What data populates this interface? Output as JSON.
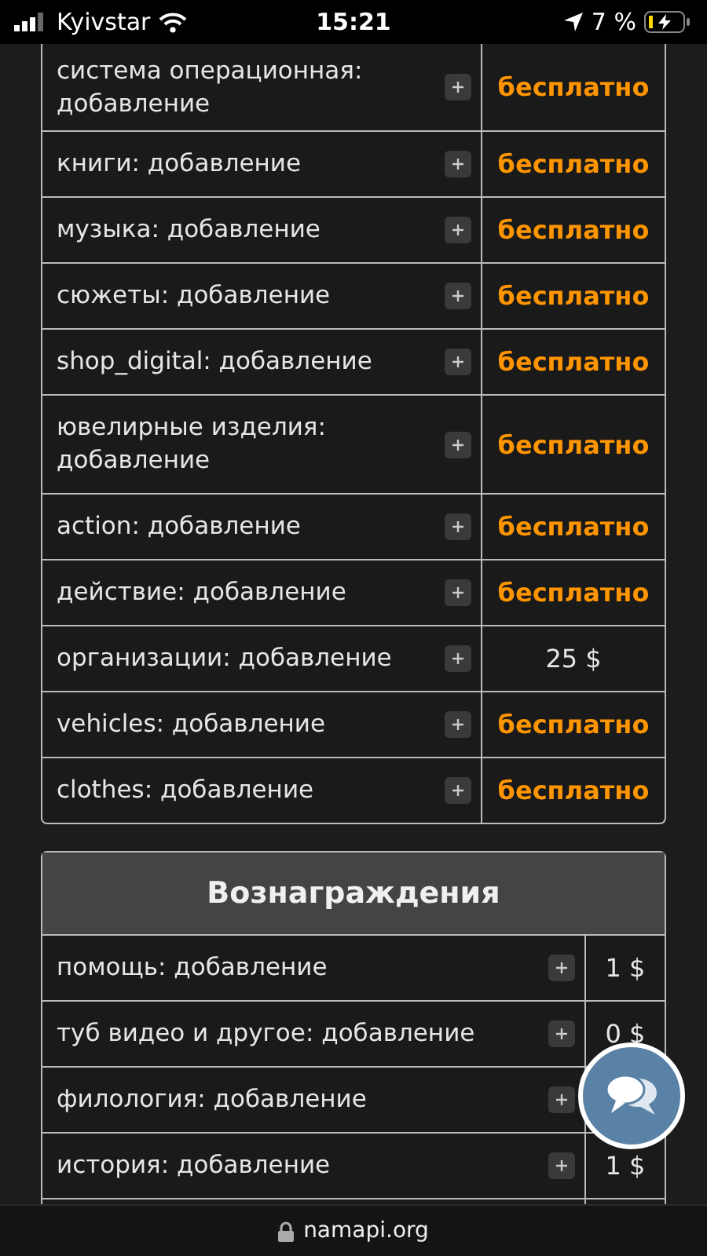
{
  "status_bar": {
    "carrier": "Kyivstar",
    "time": "15:21",
    "battery": "7 %"
  },
  "features_table": {
    "rows": [
      {
        "name": "система операционная: добавление",
        "price": "бесплатно",
        "free": true
      },
      {
        "name": "книги: добавление",
        "price": "бесплатно",
        "free": true
      },
      {
        "name": "музыка: добавление",
        "price": "бесплатно",
        "free": true
      },
      {
        "name": "сюжеты: добавление",
        "price": "бесплатно",
        "free": true
      },
      {
        "name": "shop_digital: добавление",
        "price": "бесплатно",
        "free": true
      },
      {
        "name": "ювелирные изделия: добавление",
        "price": "бесплатно",
        "free": true
      },
      {
        "name": "action: добавление",
        "price": "бесплатно",
        "free": true
      },
      {
        "name": "действие: добавление",
        "price": "бесплатно",
        "free": true
      },
      {
        "name": "организации: добавление",
        "price": "25 $",
        "free": false
      },
      {
        "name": "vehicles: добавление",
        "price": "бесплатно",
        "free": true
      },
      {
        "name": "clothes: добавление",
        "price": "бесплатно",
        "free": true
      }
    ]
  },
  "rewards_table": {
    "title": "Вознаграждения",
    "rows": [
      {
        "name": "помощь: добавление",
        "price": "1 $"
      },
      {
        "name": "туб видео и другое: добавление",
        "price": "0 $"
      },
      {
        "name": "филология: добавление"
      },
      {
        "name": "история: добавление",
        "price": "1 $"
      }
    ]
  },
  "url_bar": {
    "url": "namapi.org"
  }
}
